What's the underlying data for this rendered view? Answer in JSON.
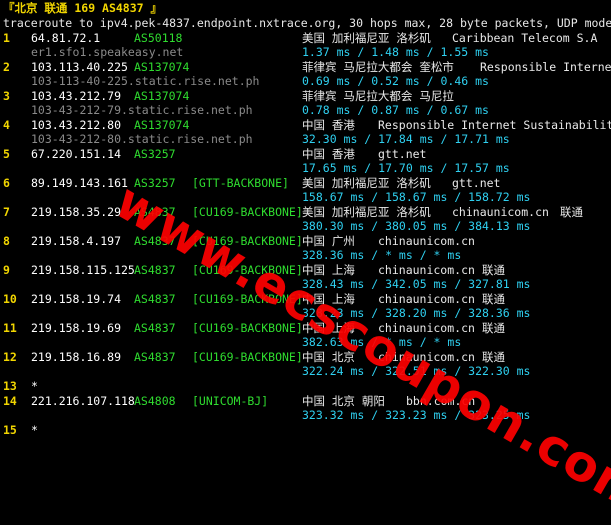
{
  "header": {
    "title": "『北京 联通 169 AS4837 』",
    "command": "traceroute to ipv4.pek-4837.endpoint.nxtrace.org, 30 hops max, 28 byte packets, UDP mode"
  },
  "hops": [
    {
      "num": "1",
      "ip": "64.81.72.1",
      "asn": "AS50118",
      "tag": "",
      "geo": "美国 加利福尼亚 洛杉矶",
      "isp": "Caribbean Telecom S.A",
      "extra": "",
      "host": "er1.sfo1.speakeasy.net",
      "times": "1.37 ms / 1.48 ms / 1.55 ms"
    },
    {
      "num": "2",
      "ip": "103.113.40.225",
      "asn": "AS137074",
      "tag": "",
      "geo": "菲律宾 马尼拉大都会 奎松市",
      "isp": "Responsible Internet",
      "extra": "",
      "host": "103-113-40-225.static.rise.net.ph",
      "times": "0.69 ms / 0.52 ms / 0.46 ms"
    },
    {
      "num": "3",
      "ip": "103.43.212.79",
      "asn": "AS137074",
      "tag": "",
      "geo": "菲律宾 马尼拉大都会 马尼拉",
      "isp": "",
      "extra": "",
      "host": "103-43-212-79.static.rise.net.ph",
      "times": "0.78 ms / 0.87 ms / 0.67 ms"
    },
    {
      "num": "4",
      "ip": "103.43.212.80",
      "asn": "AS137074",
      "tag": "",
      "geo": "中国 香港",
      "isp": "Responsible Internet Sustainability",
      "extra": "",
      "host": "103-43-212-80.static.rise.net.ph",
      "times": "32.30 ms / 17.84 ms / 17.71 ms"
    },
    {
      "num": "5",
      "ip": "67.220.151.14",
      "asn": "AS3257",
      "tag": "",
      "geo": "中国 香港",
      "isp": "gtt.net",
      "extra": "",
      "host": "",
      "times": "17.65 ms / 17.70 ms / 17.57 ms"
    },
    {
      "num": "6",
      "ip": "89.149.143.161",
      "asn": "AS3257",
      "tag": "[GTT-BACKBONE]",
      "geo": "美国 加利福尼亚 洛杉矶",
      "isp": "gtt.net",
      "extra": "",
      "host": "",
      "times": "158.67 ms / 158.67 ms / 158.72 ms"
    },
    {
      "num": "7",
      "ip": "219.158.35.29",
      "asn": "AS4837",
      "tag": "[CU169-BACKBONE]",
      "geo": "美国 加利福尼亚 洛杉矶",
      "isp": "chinaunicom.cn",
      "extra": "联通",
      "host": "",
      "times": "380.30 ms / 380.05 ms / 384.13 ms"
    },
    {
      "num": "8",
      "ip": "219.158.4.197",
      "asn": "AS4837",
      "tag": "[CU169-BACKBONE]",
      "geo": "中国 广州",
      "isp": "chinaunicom.cn",
      "extra": "",
      "host": "",
      "times": "328.36 ms / * ms / * ms"
    },
    {
      "num": "9",
      "ip": "219.158.115.125",
      "asn": "AS4837",
      "tag": "[CU169-BACKBONE]",
      "geo": "中国 上海",
      "isp": "chinaunicom.cn",
      "extra": "联通",
      "host": "",
      "times": "328.43 ms / 342.05 ms / 327.81 ms"
    },
    {
      "num": "10",
      "ip": "219.158.19.74",
      "asn": "AS4837",
      "tag": "[CU169-BACKBONE]",
      "geo": "中国 上海",
      "isp": "chinaunicom.cn",
      "extra": "联通",
      "host": "",
      "times": "328.23 ms / 328.20 ms / 328.36 ms"
    },
    {
      "num": "11",
      "ip": "219.158.19.69",
      "asn": "AS4837",
      "tag": "[CU169-BACKBONE]",
      "geo": "中国 上海",
      "isp": "chinaunicom.cn",
      "extra": "联通",
      "host": "",
      "times": "382.63 ms / * ms / * ms"
    },
    {
      "num": "12",
      "ip": "219.158.16.89",
      "asn": "AS4837",
      "tag": "[CU169-BACKBONE]",
      "geo": "中国 北京",
      "isp": "chinaunicom.cn",
      "extra": "联通",
      "host": "",
      "times": "322.24 ms / 322.51 ms / 322.30 ms"
    },
    {
      "num": "13",
      "ip": "*",
      "asn": "",
      "tag": "",
      "geo": "",
      "isp": "",
      "extra": "",
      "host": "",
      "times": ""
    },
    {
      "num": "14",
      "ip": "221.216.107.118",
      "asn": "AS4808",
      "tag": "[UNICOM-BJ]",
      "geo": "中国 北京 朝阳",
      "isp": "bbn.com.cn",
      "extra": "",
      "host": "",
      "times": "323.32 ms / 323.23 ms / 323.25 ms"
    },
    {
      "num": "15",
      "ip": "*",
      "asn": "",
      "tag": "",
      "geo": "",
      "isp": "",
      "extra": "",
      "host": "",
      "times": ""
    }
  ],
  "watermark": "www.ecscoupon.com",
  "colors": {
    "background": "#000000",
    "title": "#f2d600",
    "asn": "#2fdc2f",
    "latency": "#2fd0f0",
    "hostname": "#8a8a8a",
    "watermark": "#ff0000"
  }
}
